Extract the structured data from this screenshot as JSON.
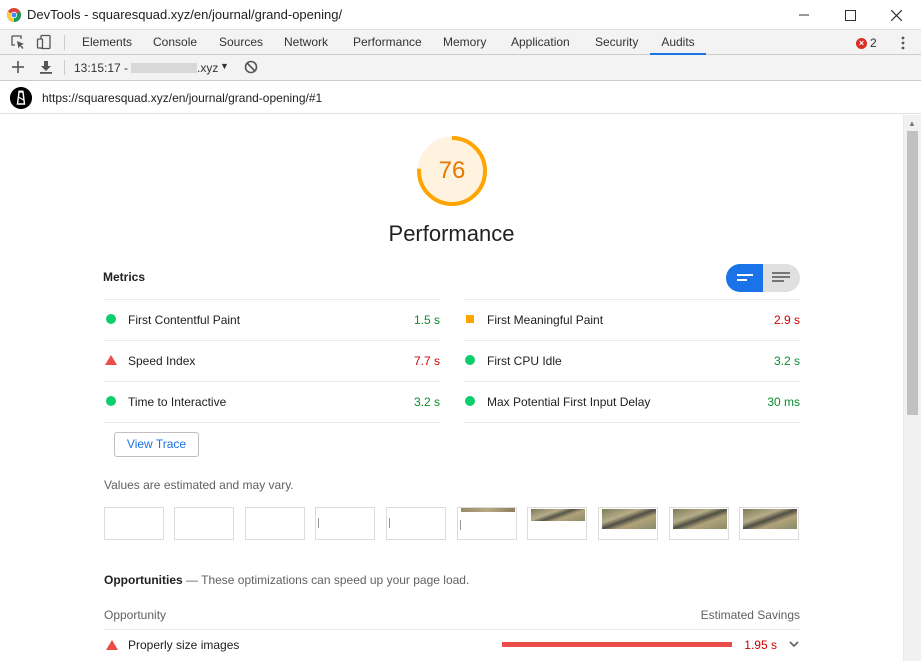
{
  "window": {
    "title": "DevTools - squaresquad.xyz/en/journal/grand-opening/",
    "icon": "chrome-logo-icon"
  },
  "devtools": {
    "tabs": [
      {
        "label": "Elements"
      },
      {
        "label": "Console"
      },
      {
        "label": "Sources"
      },
      {
        "label": "Network"
      },
      {
        "label": "Performance"
      },
      {
        "label": "Memory"
      },
      {
        "label": "Application"
      },
      {
        "label": "Security"
      },
      {
        "label": "Audits",
        "active": true
      }
    ],
    "error_count": "2"
  },
  "audits_toolbar": {
    "timestamp": "13:15:17 -",
    "domain_suffix": ".xyz"
  },
  "url_bar": {
    "url": "https://squaresquad.xyz/en/journal/grand-opening/#1"
  },
  "report": {
    "score": "76",
    "score_fraction": 0.76,
    "category_title": "Performance",
    "metrics_heading": "Metrics",
    "metrics": [
      {
        "label": "First Contentful Paint",
        "value": "1.5 s",
        "status": "pass"
      },
      {
        "label": "First Meaningful Paint",
        "value": "2.9 s",
        "status": "average"
      },
      {
        "label": "Speed Index",
        "value": "7.7 s",
        "status": "fail"
      },
      {
        "label": "First CPU Idle",
        "value": "3.2 s",
        "status": "pass"
      },
      {
        "label": "Time to Interactive",
        "value": "3.2 s",
        "status": "pass"
      },
      {
        "label": "Max Potential First Input Delay",
        "value": "30 ms",
        "status": "pass"
      }
    ],
    "view_trace_label": "View Trace",
    "estimated_note": "Values are estimated and may vary.",
    "opportunities": {
      "heading": "Opportunities",
      "subheading": " — These optimizations can speed up your page load.",
      "col_opportunity": "Opportunity",
      "col_savings": "Estimated Savings",
      "items": [
        {
          "label": "Properly size images",
          "savings": "1.95 s",
          "status": "fail"
        }
      ]
    }
  },
  "colors": {
    "accent_blue": "#1a73e8",
    "gauge_average": "#ffa400",
    "score_text": "#e67700",
    "pass_green": "#0cce6b",
    "fail_red": "#eb4d4b"
  }
}
